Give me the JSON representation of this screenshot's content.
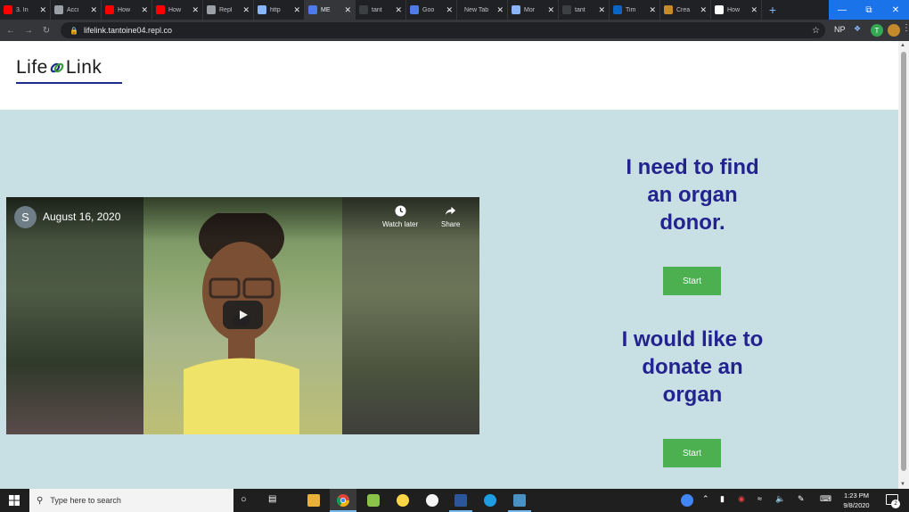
{
  "browser": {
    "tabs": [
      {
        "title": "3. In",
        "favicon_color": "#ff0000"
      },
      {
        "title": "Acci",
        "favicon_color": "#9aa0a6"
      },
      {
        "title": "How",
        "favicon_color": "#ff0000"
      },
      {
        "title": "How",
        "favicon_color": "#ff0000"
      },
      {
        "title": "Repl",
        "favicon_color": "#9aa0a6"
      },
      {
        "title": "http",
        "favicon_color": "#8ab4f8"
      },
      {
        "title": "MÉ",
        "favicon_color": "#4e7be8"
      },
      {
        "title": "tant",
        "favicon_color": "#3c4043"
      },
      {
        "title": "Goo",
        "favicon_color": "#4e7be8"
      },
      {
        "title": "New Tab",
        "favicon_color": ""
      },
      {
        "title": "Mor",
        "favicon_color": "#8ab4f8"
      },
      {
        "title": "tant",
        "favicon_color": "#3c4043"
      },
      {
        "title": "Tim",
        "favicon_color": "#0a66c2"
      },
      {
        "title": "Crea",
        "favicon_color": "#c58a2b"
      },
      {
        "title": "How",
        "favicon_color": "#ffffff"
      }
    ],
    "active_tab_index": 6,
    "close_glyph": "✕",
    "new_tab_glyph": "+",
    "url": "lifelink.tantoine04.repl.co",
    "ext_np": "NP",
    "profile_initial": "T",
    "window_controls": [
      "—",
      "⧉",
      "✕"
    ]
  },
  "site": {
    "logo_text_left": "Life",
    "logo_text_right": "Link",
    "accent_color": "#22238f",
    "button_color": "#4caf50",
    "background_color": "#c8dfe4"
  },
  "video": {
    "channel_initial": "S",
    "title": "August 16, 2020",
    "watch_later_label": "Watch later",
    "share_label": "Share"
  },
  "main": {
    "find_donor_heading": [
      "I need to find",
      "an organ",
      "donor."
    ],
    "find_donor_button": "Start",
    "donate_heading": [
      "I would like to",
      "donate an",
      "organ"
    ],
    "donate_button": "Start"
  },
  "taskbar": {
    "search_placeholder": "Type here to search",
    "time": "1:23 PM",
    "date": "9/8/2020",
    "notification_count": "2"
  }
}
